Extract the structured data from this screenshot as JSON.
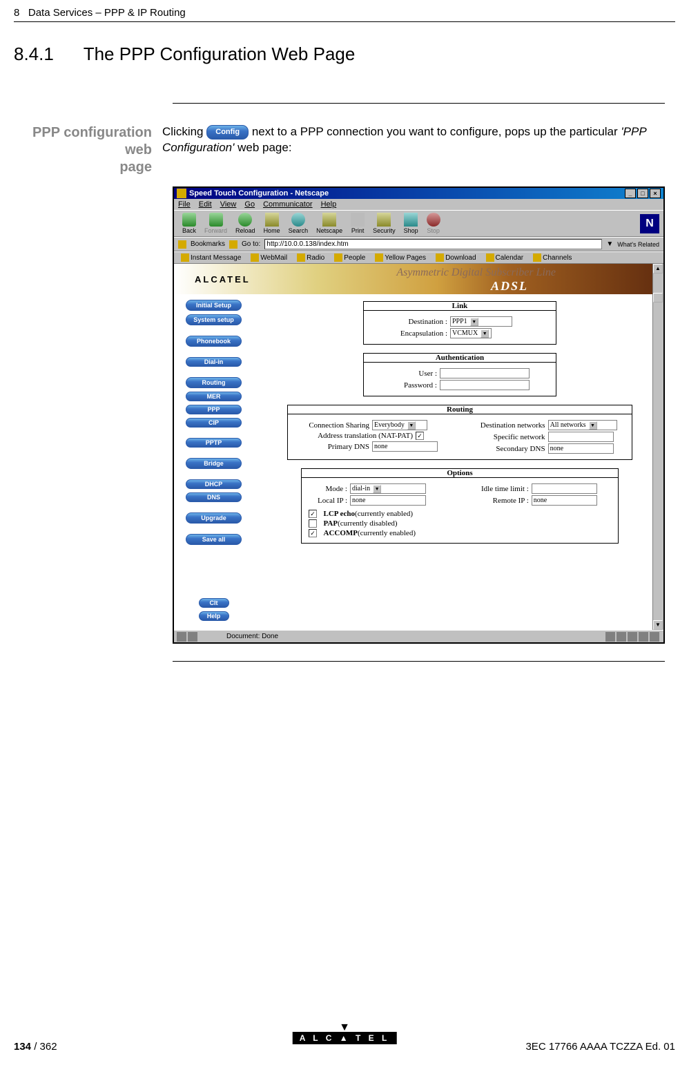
{
  "header": {
    "chapter": "8",
    "breadcrumb": "Data Services – PPP & IP Routing"
  },
  "section": {
    "number": "8.4.1",
    "title": "The PPP Configuration Web Page"
  },
  "margin_label_line1": "PPP configuration web",
  "margin_label_line2": "page",
  "body": {
    "part1": "Clicking ",
    "config_btn": "Config",
    "part2": " next to a PPP connection you want to configure, pops up the particular ",
    "italic": "'PPP Configuration'",
    "part3": " web page:"
  },
  "browser": {
    "title": "Speed Touch Configuration - Netscape",
    "menu": [
      "File",
      "Edit",
      "View",
      "Go",
      "Communicator",
      "Help"
    ],
    "toolbar": [
      {
        "label": "Back",
        "icon": "i-back",
        "disabled": false
      },
      {
        "label": "Forward",
        "icon": "i-back",
        "disabled": true
      },
      {
        "label": "Reload",
        "icon": "i-reload",
        "disabled": false
      },
      {
        "label": "Home",
        "icon": "i-home",
        "disabled": false
      },
      {
        "label": "Search",
        "icon": "i-search",
        "disabled": false
      },
      {
        "label": "Netscape",
        "icon": "i-netscape",
        "disabled": false
      },
      {
        "label": "Print",
        "icon": "i-print",
        "disabled": false
      },
      {
        "label": "Security",
        "icon": "i-security",
        "disabled": false
      },
      {
        "label": "Shop",
        "icon": "i-shop",
        "disabled": false
      },
      {
        "label": "Stop",
        "icon": "i-stop",
        "disabled": true
      }
    ],
    "bookmarks_label": "Bookmarks",
    "goto_label": "Go to:",
    "url": "http://10.0.0.138/index.htm",
    "whats_related": "What's Related",
    "linksbar": [
      "Instant Message",
      "WebMail",
      "Radio",
      "People",
      "Yellow Pages",
      "Download",
      "Calendar",
      "Channels"
    ],
    "banner_brand": "ALCATEL",
    "banner_tagline": "Asymmetric Digital Subscriber Line",
    "banner_adsl": "ADSL",
    "sidebar": [
      {
        "label": "Initial Setup"
      },
      {
        "label": "System setup"
      },
      {
        "gap": true
      },
      {
        "label": "Phonebook"
      },
      {
        "gap": true
      },
      {
        "label": "Dial-in",
        "sm": true
      },
      {
        "gap": true
      },
      {
        "label": "Routing"
      },
      {
        "label": "MER",
        "sm": true
      },
      {
        "label": "PPP",
        "sm": true
      },
      {
        "label": "CIP",
        "sm": true
      },
      {
        "gap": true
      },
      {
        "label": "PPTP",
        "sm": true
      },
      {
        "gap": true
      },
      {
        "label": "Bridge"
      },
      {
        "gap": true
      },
      {
        "label": "DHCP",
        "sm": true
      },
      {
        "label": "DNS",
        "sm": true
      },
      {
        "gap": true
      },
      {
        "label": "Upgrade"
      },
      {
        "gap": true
      },
      {
        "label": "Save all"
      }
    ],
    "sidebar_bottom": [
      {
        "label": "Clt",
        "sm": true
      },
      {
        "label": "Help",
        "sm": true
      }
    ],
    "forms": {
      "link": {
        "title": "Link",
        "destination_label": "Destination :",
        "destination_value": "PPP1",
        "encapsulation_label": "Encapsulation :",
        "encapsulation_value": "VCMUX"
      },
      "auth": {
        "title": "Authentication",
        "user_label": "User :",
        "password_label": "Password :"
      },
      "routing": {
        "title": "Routing",
        "conn_sharing_label": "Connection Sharing",
        "conn_sharing_value": "Everybody",
        "nat_label": "Address translation (NAT-PAT)",
        "nat_checked": "✓",
        "primary_dns_label": "Primary DNS",
        "primary_dns_value": "none",
        "dest_net_label": "Destination networks",
        "dest_net_value": "All networks",
        "spec_net_label": "Specific network",
        "sec_dns_label": "Secondary DNS",
        "sec_dns_value": "none"
      },
      "options": {
        "title": "Options",
        "mode_label": "Mode :",
        "mode_value": "dial-in",
        "local_ip_label": "Local IP :",
        "local_ip_value": "none",
        "idle_label": "Idle time limit :",
        "remote_ip_label": "Remote IP :",
        "remote_ip_value": "none",
        "lcp": {
          "checked": "✓",
          "bold": "LCP echo",
          "rest": "(currently enabled)"
        },
        "pap": {
          "checked": "",
          "bold": "PAP",
          "rest": "(currently disabled)"
        },
        "accomp": {
          "checked": "✓",
          "bold": "ACCOMP",
          "rest": "(currently enabled)"
        }
      }
    },
    "status": "Document: Done"
  },
  "footer": {
    "page_current": "134",
    "page_total": "362",
    "doc_ref": "3EC 17766 AAAA TCZZA Ed. 01",
    "brand": "A L C ▲ T E L"
  }
}
